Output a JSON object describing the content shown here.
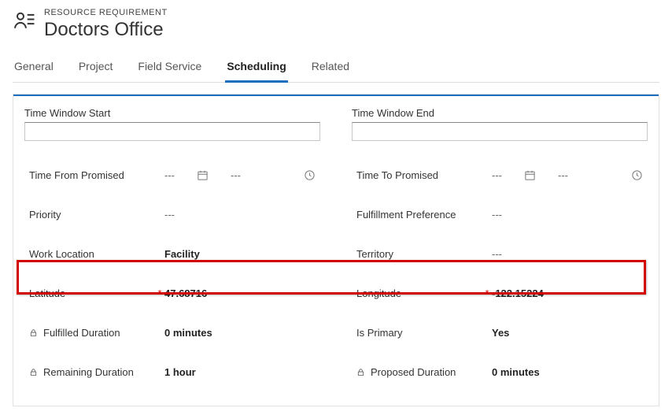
{
  "header": {
    "label": "RESOURCE REQUIREMENT",
    "title": "Doctors Office"
  },
  "tabs": [
    {
      "label": "General",
      "active": false
    },
    {
      "label": "Project",
      "active": false
    },
    {
      "label": "Field Service",
      "active": false
    },
    {
      "label": "Scheduling",
      "active": true
    },
    {
      "label": "Related",
      "active": false
    }
  ],
  "sections": {
    "left": {
      "title": "Time Window Start"
    },
    "right": {
      "title": "Time Window End"
    }
  },
  "fields": {
    "left": {
      "timeFromPromised": {
        "label": "Time From Promised",
        "date": "---",
        "time": "---"
      },
      "priority": {
        "label": "Priority",
        "value": "---"
      },
      "workLocation": {
        "label": "Work Location",
        "value": "Facility"
      },
      "latitude": {
        "label": "Latitude",
        "value": "47.68716",
        "required": true
      },
      "fulfilledDuration": {
        "label": "Fulfilled Duration",
        "value": "0 minutes",
        "locked": true
      },
      "remainingDuration": {
        "label": "Remaining Duration",
        "value": "1 hour",
        "locked": true
      }
    },
    "right": {
      "timeToPromised": {
        "label": "Time To Promised",
        "date": "---",
        "time": "---"
      },
      "fulfillmentPreference": {
        "label": "Fulfillment Preference",
        "value": "---"
      },
      "territory": {
        "label": "Territory",
        "value": "---"
      },
      "longitude": {
        "label": "Longitude",
        "value": "-122.15224",
        "required": true
      },
      "isPrimary": {
        "label": "Is Primary",
        "value": "Yes"
      },
      "proposedDuration": {
        "label": "Proposed Duration",
        "value": "0 minutes",
        "locked": true
      }
    }
  }
}
